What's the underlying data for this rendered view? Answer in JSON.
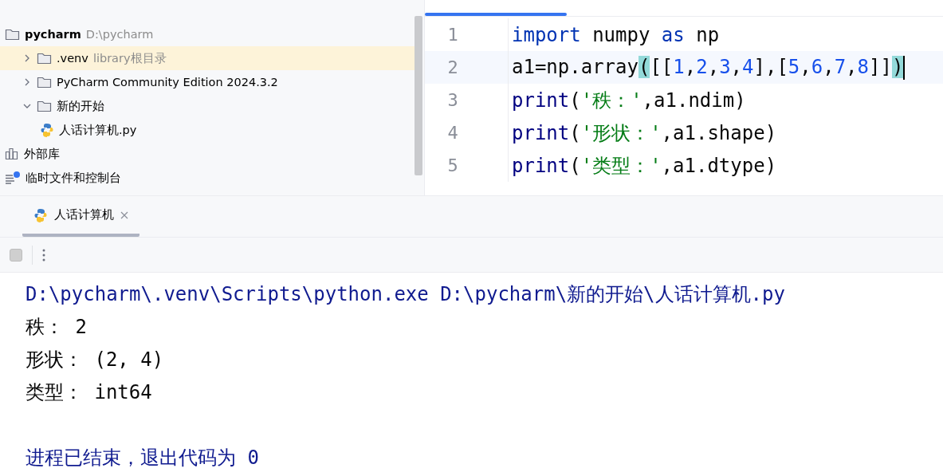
{
  "project_tree": [
    {
      "kind": "folder",
      "name": "pycharm",
      "hint": "D:\\pycharm",
      "bold": true,
      "selected": false,
      "children": [
        {
          "kind": "folder",
          "name": ".venv",
          "hint": "library根目录",
          "expanded": false,
          "selected": true
        },
        {
          "kind": "folder",
          "name": "PyCharm Community Edition 2024.3.2",
          "expanded": false,
          "selected": false
        },
        {
          "kind": "folder",
          "name": "新的开始",
          "expanded": true,
          "selected": false,
          "children": [
            {
              "kind": "python",
              "name": "人话计算机.py",
              "selected": false
            }
          ]
        }
      ]
    },
    {
      "kind": "library",
      "name": "外部库",
      "selected": false
    },
    {
      "kind": "scratch",
      "name": "临时文件和控制台",
      "selected": false
    }
  ],
  "editor": {
    "lines": [
      {
        "number": "1",
        "current": false,
        "tokens": [
          {
            "kind": "keyword",
            "text": "import"
          },
          {
            "kind": "plain",
            "text": " numpy "
          },
          {
            "kind": "keyword",
            "text": "as"
          },
          {
            "kind": "plain",
            "text": " np"
          }
        ]
      },
      {
        "number": "2",
        "current": true,
        "tokens": [
          {
            "kind": "plain",
            "text": "a1=np.array"
          },
          {
            "kind": "match",
            "text": "("
          },
          {
            "kind": "plain",
            "text": "[["
          },
          {
            "kind": "number",
            "text": "1"
          },
          {
            "kind": "plain",
            "text": ","
          },
          {
            "kind": "number",
            "text": "2"
          },
          {
            "kind": "plain",
            "text": ","
          },
          {
            "kind": "number",
            "text": "3"
          },
          {
            "kind": "plain",
            "text": ","
          },
          {
            "kind": "number",
            "text": "4"
          },
          {
            "kind": "plain",
            "text": "],["
          },
          {
            "kind": "number",
            "text": "5"
          },
          {
            "kind": "plain",
            "text": ","
          },
          {
            "kind": "number",
            "text": "6"
          },
          {
            "kind": "plain",
            "text": ","
          },
          {
            "kind": "number",
            "text": "7"
          },
          {
            "kind": "plain",
            "text": ","
          },
          {
            "kind": "number",
            "text": "8"
          },
          {
            "kind": "plain",
            "text": "]]"
          },
          {
            "kind": "match",
            "text": ")"
          }
        ]
      },
      {
        "number": "3",
        "current": false,
        "tokens": [
          {
            "kind": "builtin",
            "text": "print"
          },
          {
            "kind": "plain",
            "text": "("
          },
          {
            "kind": "string",
            "text": "'秩：'"
          },
          {
            "kind": "plain",
            "text": ",a1.ndim)"
          }
        ]
      },
      {
        "number": "4",
        "current": false,
        "tokens": [
          {
            "kind": "builtin",
            "text": "print"
          },
          {
            "kind": "plain",
            "text": "("
          },
          {
            "kind": "string",
            "text": "'形状：'"
          },
          {
            "kind": "plain",
            "text": ",a1.shape)"
          }
        ]
      },
      {
        "number": "5",
        "current": false,
        "tokens": [
          {
            "kind": "builtin",
            "text": "print"
          },
          {
            "kind": "plain",
            "text": "("
          },
          {
            "kind": "string",
            "text": "'类型：'"
          },
          {
            "kind": "plain",
            "text": ",a1.dtype)"
          }
        ]
      }
    ]
  },
  "run_tabs": [
    {
      "label": "人话计算机",
      "selected": true
    }
  ],
  "console": [
    {
      "kind": "system",
      "text": "D:\\pycharm\\.venv\\Scripts\\python.exe D:\\pycharm\\新的开始\\人话计算机.py"
    },
    {
      "kind": "output",
      "text": "秩： 2"
    },
    {
      "kind": "output",
      "text": "形状： (2, 4)"
    },
    {
      "kind": "output",
      "text": "类型： int64"
    },
    {
      "kind": "blank"
    },
    {
      "kind": "system",
      "text": "进程已结束，退出代码为 0"
    }
  ]
}
